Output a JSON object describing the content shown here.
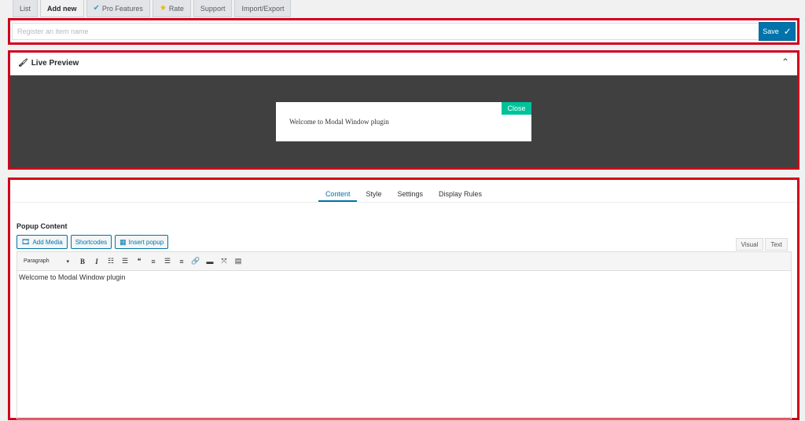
{
  "tabs": [
    {
      "label": "List",
      "icon": ""
    },
    {
      "label": "Add new",
      "icon": ""
    },
    {
      "label": "Pro Features",
      "icon": "check-icon"
    },
    {
      "label": "Rate",
      "icon": "star-icon"
    },
    {
      "label": "Support",
      "icon": ""
    },
    {
      "label": "Import/Export",
      "icon": ""
    }
  ],
  "name_field": {
    "placeholder": "Register an item name",
    "value": ""
  },
  "save_button": {
    "label": "Save"
  },
  "preview": {
    "title": "Live Preview",
    "modal_text": "Welcome to Modal Window plugin",
    "close_label": "Close"
  },
  "editor_tabs": [
    "Content",
    "Style",
    "Settings",
    "Display Rules"
  ],
  "content": {
    "heading": "Popup Content",
    "buttons": {
      "add_media": "Add Media",
      "shortcodes": "Shortcodes",
      "insert_popup": "Insert popup"
    },
    "modes": {
      "visual": "Visual",
      "text": "Text"
    },
    "format_select": "Paragraph",
    "body_text": "Welcome to Modal Window plugin"
  },
  "colors": {
    "accent": "#0073aa",
    "highlight": "#d0021b",
    "close": "#00c29a",
    "stage": "#404040"
  }
}
